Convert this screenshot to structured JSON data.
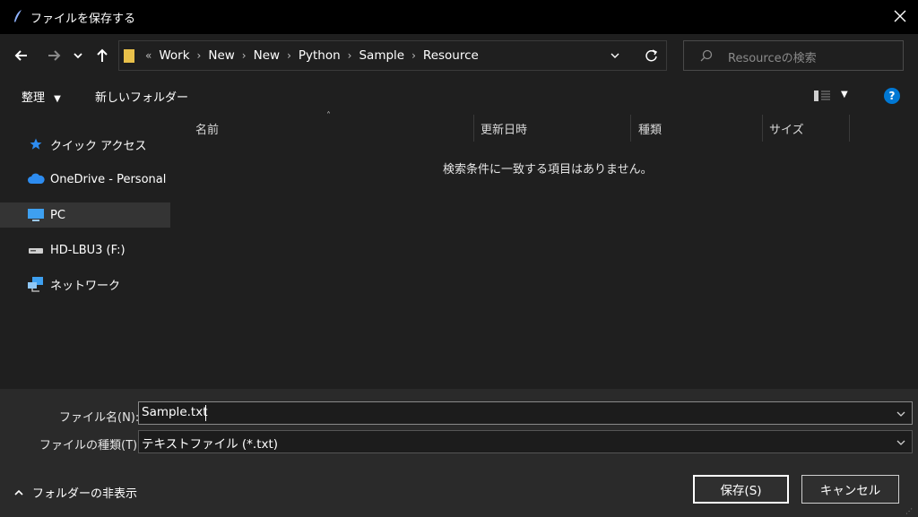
{
  "window": {
    "title": "ファイルを保存する"
  },
  "nav": {
    "path_prefix": "«",
    "breadcrumbs": [
      "Work",
      "New",
      "New",
      "Python",
      "Sample",
      "Resource"
    ],
    "search_placeholder": "Resourceの検索"
  },
  "toolbar": {
    "organize": "整理",
    "new_folder": "新しいフォルダー",
    "help": "?"
  },
  "sidebar": {
    "items": [
      {
        "label": "クイック アクセス",
        "icon": "star-icon"
      },
      {
        "label": "OneDrive - Personal",
        "icon": "cloud-icon"
      },
      {
        "label": "PC",
        "icon": "monitor-icon",
        "selected": true
      },
      {
        "label": "HD-LBU3 (F:)",
        "icon": "drive-icon"
      },
      {
        "label": "ネットワーク",
        "icon": "network-icon"
      }
    ]
  },
  "columns": [
    "名前",
    "更新日時",
    "種類",
    "サイズ"
  ],
  "empty_message": "検索条件に一致する項目はありません。",
  "form": {
    "filename_label": "ファイル名(N):",
    "filename_value": "Sample.txt",
    "filetype_label": "ファイルの種類(T):",
    "filetype_value": "テキストファイル (*.txt)"
  },
  "footer": {
    "hide_folders": "フォルダーの非表示",
    "save_button": "保存(S)",
    "cancel_button": "キャンセル"
  },
  "colors": {
    "accent": "#0078d4",
    "folder": "#e8c04a"
  }
}
